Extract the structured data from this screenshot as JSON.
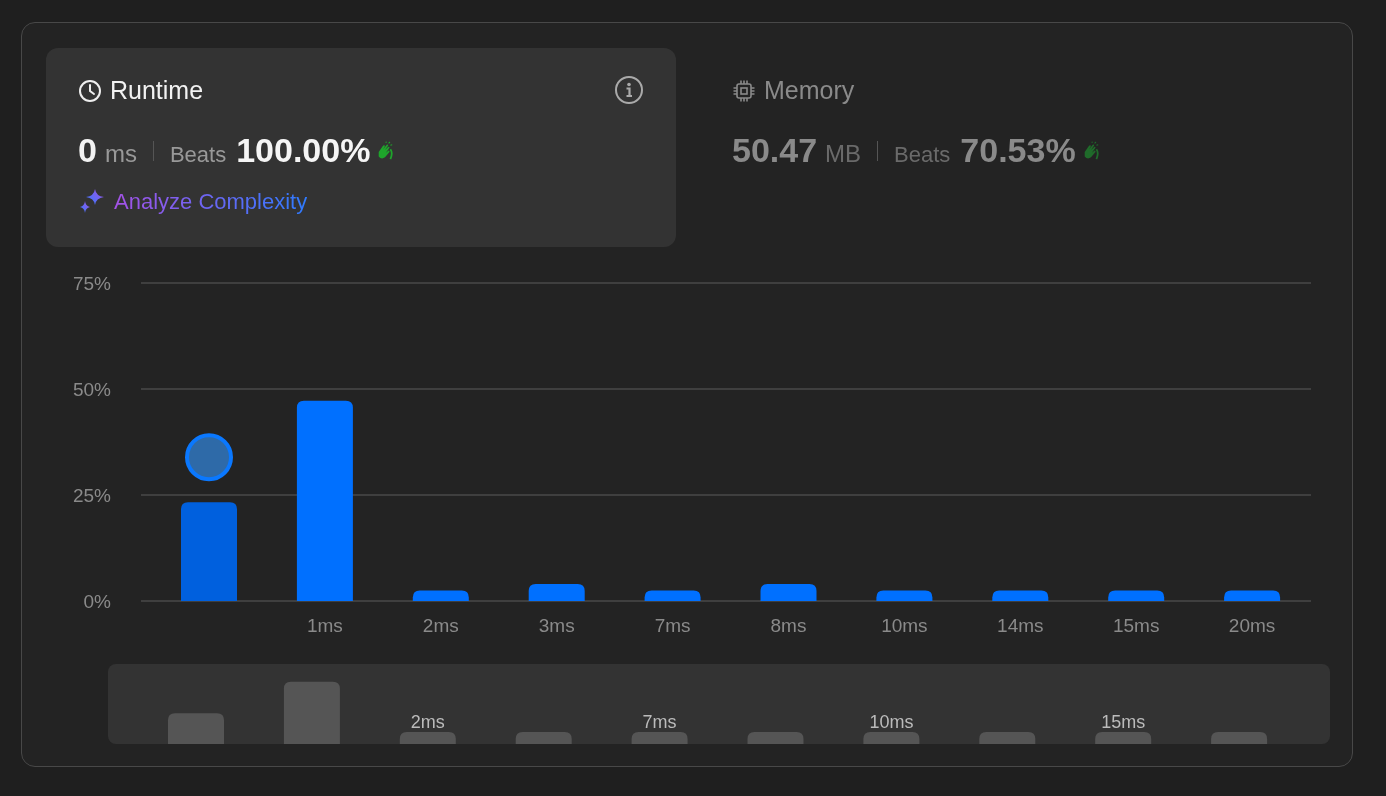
{
  "panels": [
    {
      "kind": "runtime",
      "title": "Runtime",
      "selected": true,
      "value": "0",
      "unit": "ms",
      "beats_label": "Beats",
      "beats": "100.00%",
      "link": "Analyze Complexity"
    },
    {
      "kind": "memory",
      "title": "Memory",
      "selected": false,
      "value": "50.47",
      "unit": "MB",
      "beats_label": "Beats",
      "beats": "70.53%"
    }
  ],
  "chart": {
    "chart_data": {
      "type": "bar",
      "categories": [
        null,
        "1ms",
        "2ms",
        "3ms",
        "7ms",
        "8ms",
        "10ms",
        "14ms",
        "15ms",
        "20ms"
      ],
      "values": [
        23.3,
        47.2,
        2.5,
        4,
        2.5,
        4,
        2.5,
        2.5,
        2.5,
        2.5
      ],
      "ylim": [
        0,
        75
      ],
      "yticks": [
        {
          "value": 0,
          "label": "0%"
        },
        {
          "value": 25,
          "label": "25%"
        },
        {
          "value": 50,
          "label": "50%"
        },
        {
          "value": 75,
          "label": "75%"
        }
      ]
    },
    "bars": [
      {
        "selected": true
      },
      {
        "selected": false
      },
      {
        "selected": false
      },
      {
        "selected": false
      },
      {
        "selected": false
      },
      {
        "selected": false
      },
      {
        "selected": false
      },
      {
        "selected": false
      },
      {
        "selected": false
      },
      {
        "selected": false
      }
    ]
  },
  "navigator": {
    "labels": [
      "2ms",
      "7ms",
      "10ms",
      "15ms"
    ]
  }
}
